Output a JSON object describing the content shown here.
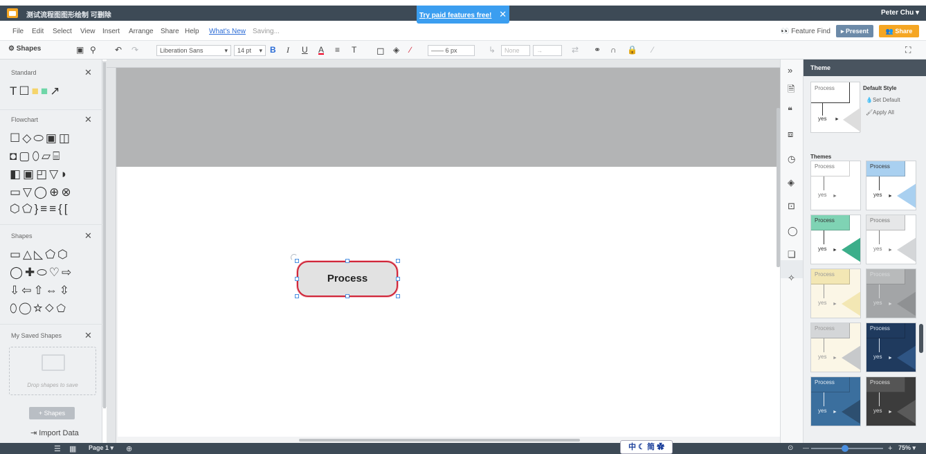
{
  "titlebar": {
    "doc_title": "测试流程图图形绘制 可删除",
    "user": "Peter Chu ▾",
    "promo_text": "Try paid features free!",
    "promo_close": "✕"
  },
  "menubar": {
    "items": [
      "File",
      "Edit",
      "Select",
      "View",
      "Insert",
      "Arrange",
      "Share",
      "Help"
    ],
    "whats_new": "What's New",
    "status": "Saving...",
    "feature_find": "Feature Find",
    "present_label": "▸ Present",
    "share_label": "Share"
  },
  "toolbar": {
    "shapes_label": "Shapes",
    "font_family": "Liberation Sans",
    "font_size": "14 pt",
    "line_width": "6 px",
    "arrow_style": "None"
  },
  "left_panel": {
    "libraries": [
      {
        "title": "Standard",
        "shapes": "T☐▭■↗"
      },
      {
        "title": "Flowchart",
        "rows": [
          "☐◇⬭▣◫",
          "◘▢⬯▱⌸",
          "◧▣◰▽◗",
          "▭▽◯⊕⊗",
          "⬡⬠}≡≡{["
        ]
      },
      {
        "title": "Shapes",
        "rows": [
          "▭△◺⬠⬡",
          "◯✚⬭♡⇨",
          "⇩⇦⇧⇔⇳",
          "⬯◯☆◇⬠"
        ]
      },
      {
        "title": "My Saved Shapes"
      }
    ],
    "drop_text": "Drop shapes to save",
    "add_shapes": "+ Shapes",
    "import_data": "Import Data"
  },
  "canvas": {
    "shape_label": "Process",
    "shape_border_color": "#d0273a",
    "shape_fill": "#e2e2e2"
  },
  "theme_panel": {
    "header": "Theme",
    "default_style": "Default Style",
    "set_default": "Set Default",
    "apply_all": "Apply All",
    "themes_label": "Themes",
    "card_process": "Process",
    "card_yes": "yes",
    "themes": [
      {
        "bg": "#ffffff",
        "box": "#ffffff",
        "text": "#777777",
        "accent": "#ffffff"
      },
      {
        "bg": "#ffffff",
        "box": "#a9d0f0",
        "text": "#333333",
        "accent": "#a9d0f0"
      },
      {
        "bg": "#ffffff",
        "box": "#7fd3b4",
        "text": "#333333",
        "accent": "#3cae8a"
      },
      {
        "bg": "#ffffff",
        "box": "#e6e7e8",
        "text": "#777777",
        "accent": "#d4d6d8"
      },
      {
        "bg": "#fbf6e6",
        "box": "#f3e7b4",
        "text": "#999999",
        "accent": "#f3e7b4"
      },
      {
        "bg": "#a3a5a7",
        "box": "#b8babb",
        "text": "#d8dadb",
        "accent": "#8f9193"
      },
      {
        "bg": "#fbf6e6",
        "box": "#d4d6d8",
        "text": "#999999",
        "accent": "#c7c9cb"
      },
      {
        "bg": "#1f3a5e",
        "box": "#1f3a5e",
        "text": "#d8e2ee",
        "accent": "#2f5584"
      },
      {
        "bg": "#3b6f9e",
        "box": "#3b6f9e",
        "text": "#e4ecf4",
        "accent": "#2d4f70"
      },
      {
        "bg": "#3c3c3c",
        "box": "#555555",
        "text": "#dddddd",
        "accent": "#5a5a5a"
      }
    ]
  },
  "statusbar": {
    "page_label": "Page 1 ▾",
    "zoom": "75% ▾",
    "ime_text": "中 ☾ 简 ✿"
  }
}
